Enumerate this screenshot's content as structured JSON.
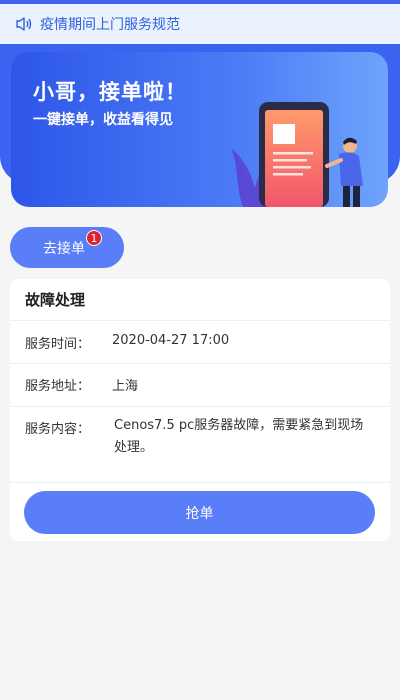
{
  "notice": {
    "icon": "speaker-icon",
    "text": "疫情期间上门服务规范"
  },
  "banner": {
    "headline": "小哥，接单啦！",
    "subline": "一键接单，收益看得见"
  },
  "go_button": {
    "label": "去接单",
    "badge_count": "1"
  },
  "order_card": {
    "title": "故障处理",
    "rows": [
      {
        "label": "服务时间：",
        "value": "2020-04-27 17:00"
      },
      {
        "label": "服务地址：",
        "value": "上海"
      },
      {
        "label": "服务内容：",
        "value": "Cenos7.5 pc服务器故障，需要紧急到现场处理。"
      }
    ],
    "grab_label": "抢单"
  },
  "colors": {
    "primary": "#3d63ef",
    "button": "#5a7df8",
    "badge": "#d9232e",
    "notice_bg": "#eaf2fd"
  }
}
